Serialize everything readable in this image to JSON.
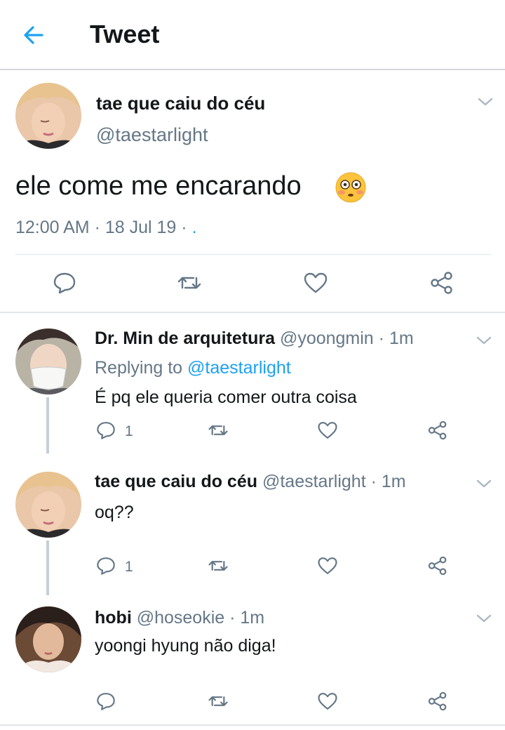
{
  "header": {
    "title": "Tweet",
    "back_icon": "arrow-left-icon",
    "accent": "#1da1f2"
  },
  "tweet": {
    "name": "tae que caiu do céu",
    "handle": "@taestarlight",
    "text": "ele come me encarando",
    "emoji": "flushed-face-emoji",
    "time": "12:00 AM",
    "date": "18 Jul 19",
    "source": ".",
    "sep1": "·",
    "sep2": "·"
  },
  "replies": [
    {
      "name": "Dr. Min de arquitetura",
      "handle": "@yoongmin",
      "time": "1m",
      "replying_prefix": "Replying to",
      "replying_to": "@taestarlight",
      "text": "É pq ele queria comer outra coisa",
      "reply_count": "1"
    },
    {
      "name": "tae que caiu do céu",
      "handle": "@taestarlight",
      "time": "1m",
      "text": "oq??",
      "reply_count": "1"
    },
    {
      "name": "hobi",
      "handle": "@hoseokie",
      "time": "1m",
      "text": "yoongi hyung não diga!"
    }
  ],
  "icons": [
    "reply-icon",
    "retweet-icon",
    "like-icon",
    "share-icon",
    "chevron-down-icon"
  ],
  "colors": {
    "text": "#14171a",
    "secondary": "#657786",
    "link": "#1da1f2",
    "thread": "#c4cfd6"
  }
}
